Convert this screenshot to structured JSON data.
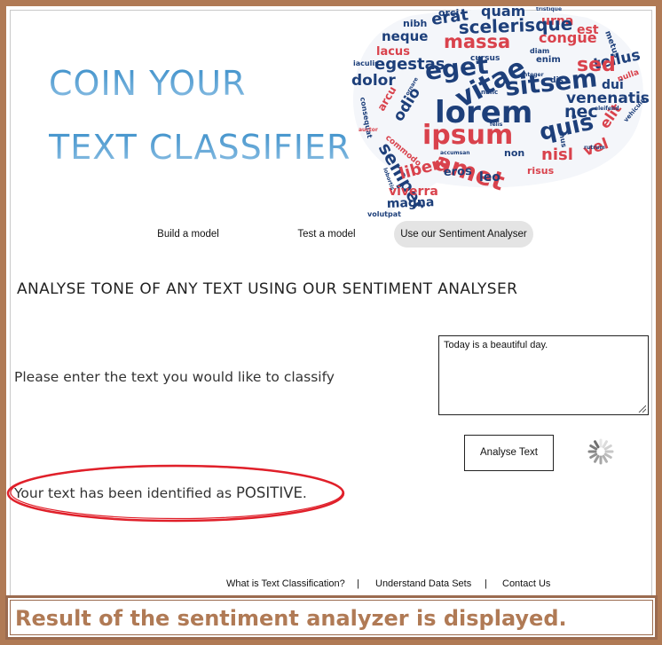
{
  "header": {
    "title_line1": "COIN YOUR",
    "title_line2": "TEXT CLASSIFIER"
  },
  "word_cloud": {
    "colors": {
      "blue": "#1d3f7a",
      "red": "#d9424c"
    },
    "words": [
      "orci",
      "quam",
      "tristique",
      "nibh",
      "erat",
      "urna",
      "scelerisque",
      "neque",
      "massa",
      "congue",
      "est",
      "metus",
      "lacus",
      "egestas",
      "diam",
      "tellus",
      "iaculis",
      "cursus",
      "enim",
      "sed",
      "dolor",
      "eget",
      "vitae",
      "sitsem",
      "dui",
      "nulla",
      "consequat",
      "odio",
      "lorem",
      "venenatis",
      "arcu",
      "nec",
      "elit",
      "vehicula",
      "semper",
      "ipsum",
      "quis",
      "commodo",
      "amet",
      "nisl",
      "vel",
      "nunc",
      "libero",
      "eros",
      "leo",
      "non",
      "risus",
      "viverra",
      "magna",
      "volutpat",
      "felis",
      "accumsan",
      "lobortis",
      "rutrum",
      "eleifend",
      "dis",
      "mus",
      "auctor",
      "ornare",
      "integer"
    ]
  },
  "nav": {
    "tabs": [
      "Build a  model",
      "Test a model",
      "Use our Sentiment Analyser"
    ],
    "active_index": 2
  },
  "main": {
    "heading": "ANALYSE TONE OF ANY TEXT USING OUR SENTIMENT ANALYSER",
    "prompt": "Please enter the text you would like to classify",
    "input_value": "Today is a beautiful day.",
    "button_label": "Analyse Text",
    "result_prefix": "Your text has been identified as ",
    "result_value": "POSITIVE",
    "result_suffix": "."
  },
  "footer": {
    "links": [
      "What is Text Classification?",
      "Understand Data Sets",
      "Contact Us"
    ],
    "separator": "|"
  },
  "caption": "Result of the sentiment analyzer is displayed.",
  "colors": {
    "frame": "#b07a55",
    "title_blue": "#3a8ec9",
    "highlight_circle": "#e0202a",
    "active_tab_bg": "#e4e4e4"
  }
}
